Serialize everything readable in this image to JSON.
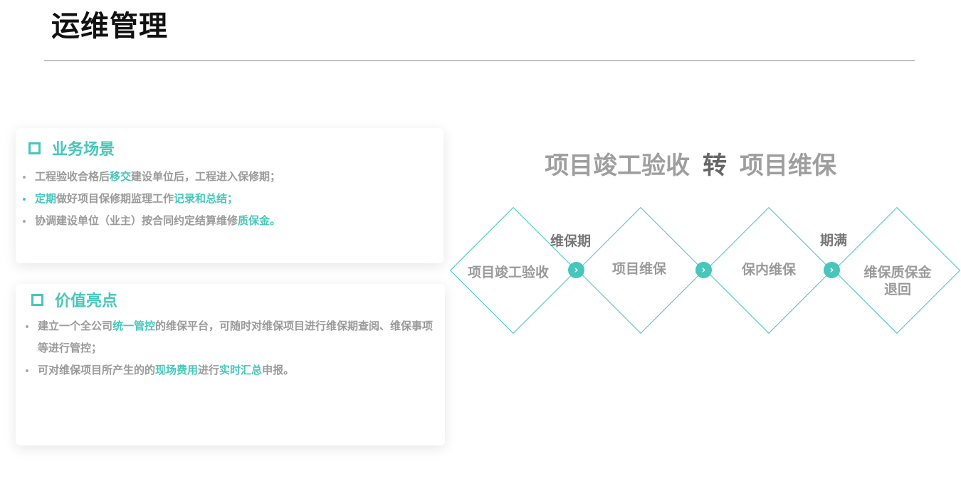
{
  "title": "运维管理",
  "business": {
    "heading": "业务场景",
    "items": [
      {
        "p1": "工程验收合格后",
        "h1": "移交",
        "p2": "建设单位后，工程进入保修期；"
      },
      {
        "h1": "定期",
        "p1": "做好项目保修期监理工作",
        "h2": "记录和总结；"
      },
      {
        "p1": "协调建设单位（业主）按合同约定结算维修",
        "h1": "质保金。"
      }
    ]
  },
  "value": {
    "heading": "价值亮点",
    "items": [
      {
        "p1": "建立一个全公司",
        "h1": "统一管控",
        "p2": "的维保平台，可随时对维保项目进行维保期查阅、维保事项等进行管控；"
      },
      {
        "p1": "可对维保项目所产生的的",
        "h1": "现场费用",
        "p2": "进行",
        "h2": "实时汇总",
        "p3": "申报。"
      }
    ]
  },
  "flow": {
    "title_left": "项目竣工验收",
    "title_mid": "转",
    "title_right": "项目维保",
    "steps": [
      "项目竣工验收",
      "项目维保",
      "保内维保",
      "维保质保金退回"
    ],
    "connector_labels": [
      "维保期",
      "期满"
    ],
    "arrow_glyph": "›"
  },
  "colors": {
    "accent": "#46c7bb",
    "text_gray": "#9a9a9a"
  }
}
